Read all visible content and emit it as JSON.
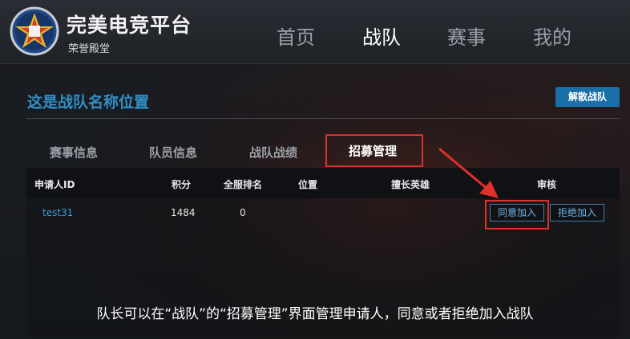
{
  "brand": {
    "title": "完美电竞平台",
    "subtitle": "荣誉殿堂"
  },
  "nav": [
    {
      "label": "首页",
      "active": false
    },
    {
      "label": "战队",
      "active": true
    },
    {
      "label": "赛事",
      "active": false
    },
    {
      "label": "我的",
      "active": false
    }
  ],
  "team": {
    "name": "这是战队名称位置",
    "disband_label": "解散战队"
  },
  "tabs": [
    {
      "label": "赛事信息",
      "active": false
    },
    {
      "label": "队员信息",
      "active": false
    },
    {
      "label": "战队战绩",
      "active": false
    },
    {
      "label": "招募管理",
      "active": true
    }
  ],
  "table": {
    "headers": [
      "申请人ID",
      "积分",
      "全服排名",
      "位置",
      "擅长英雄",
      "审核"
    ],
    "rows": [
      {
        "id": "test31",
        "points": "1484",
        "rank": "0",
        "position": "",
        "hero": ""
      }
    ],
    "approve_label": "同意加入",
    "reject_label": "拒绝加入"
  },
  "caption": "队长可以在“战队”的“招募管理”界面管理申请人，同意或者拒绝加入战队",
  "colors": {
    "accent": "#2f8fc7",
    "highlight": "#e0302a",
    "button": "#1b6fa8"
  }
}
